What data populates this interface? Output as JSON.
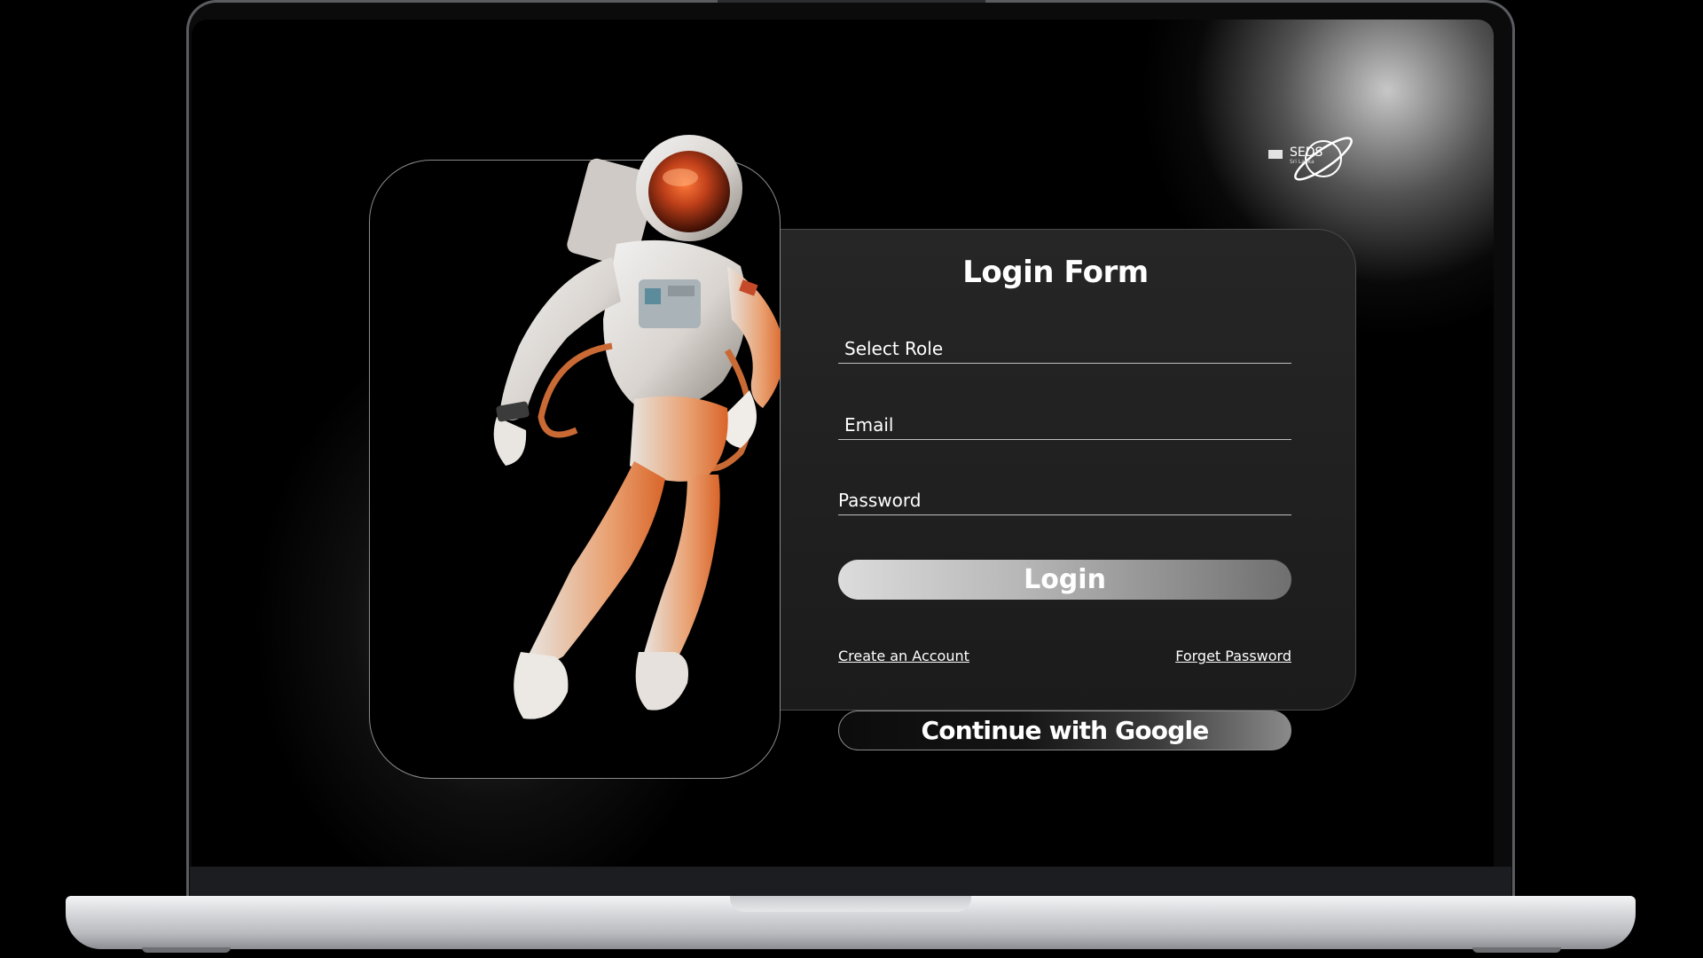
{
  "brand": {
    "logo_name": "SEDS",
    "logo_sub": "Sri Lanka"
  },
  "form": {
    "title": "Login Form",
    "fields": [
      {
        "label": "Select Role"
      },
      {
        "label": "Email"
      },
      {
        "label": "Password"
      }
    ],
    "login_label": "Login",
    "create_account_link": "Create an Account",
    "forget_password_link": "Forget Password",
    "google_label": "Continue with Google"
  },
  "colors": {
    "background": "#000000",
    "panel": "#1f1f1f",
    "accent_orange": "#e0662a",
    "text": "#ffffff"
  },
  "icons": {
    "logo": "planet-ring-icon"
  }
}
